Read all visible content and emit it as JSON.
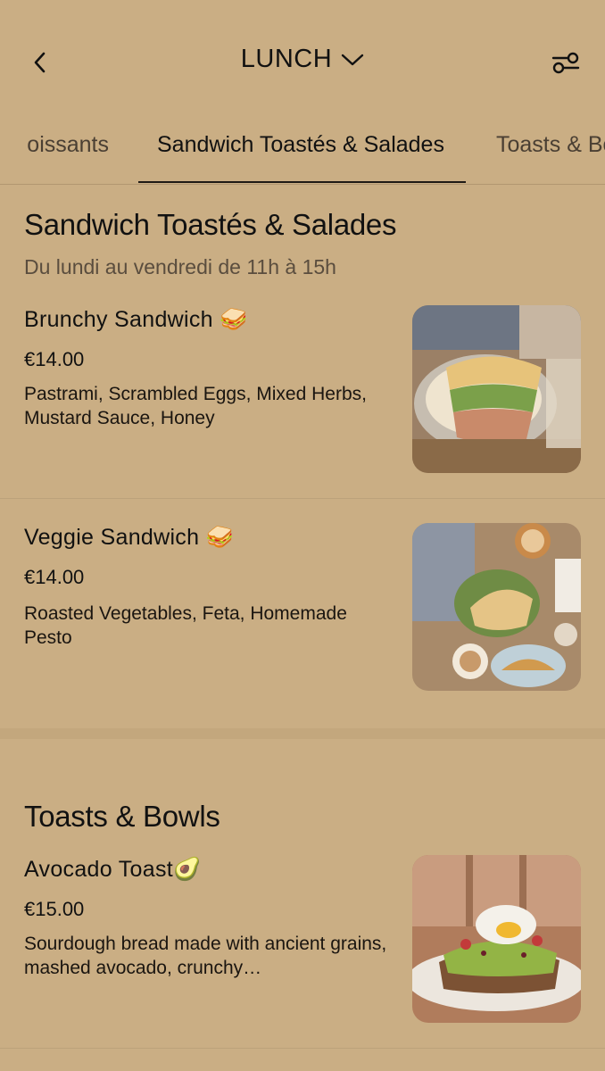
{
  "header": {
    "title": "LUNCH",
    "back_icon": "chevron-left-icon",
    "dropdown_icon": "chevron-down-icon",
    "filter_icon": "sliders-icon"
  },
  "tabs": [
    {
      "label": "Croissants"
    },
    {
      "label": "Sandwich Toastés & Salades"
    },
    {
      "label": "Toasts & Bowls"
    }
  ],
  "sections": [
    {
      "title": "Sandwich Toastés & Salades",
      "subtitle": "Du lundi au vendredi de 11h à 15h",
      "items": [
        {
          "name": "Brunchy Sandwich 🥪",
          "price": "€14.00",
          "description": "Pastrami, Scrambled Eggs, Mixed Herbs, Mustard Sauce, Honey"
        },
        {
          "name": "Veggie Sandwich 🥪",
          "price": "€14.00",
          "description": "Roasted Vegetables, Feta, Homemade Pesto"
        }
      ]
    },
    {
      "title": "Toasts & Bowls",
      "items": [
        {
          "name": "Avocado Toast🥑",
          "price": "€15.00",
          "description": "Sourdough bread made with ancient grains, mashed avocado, crunchy…"
        }
      ]
    }
  ],
  "colors": {
    "background": "#caae84",
    "text": "#111111",
    "muted": "#5a4d3e"
  }
}
